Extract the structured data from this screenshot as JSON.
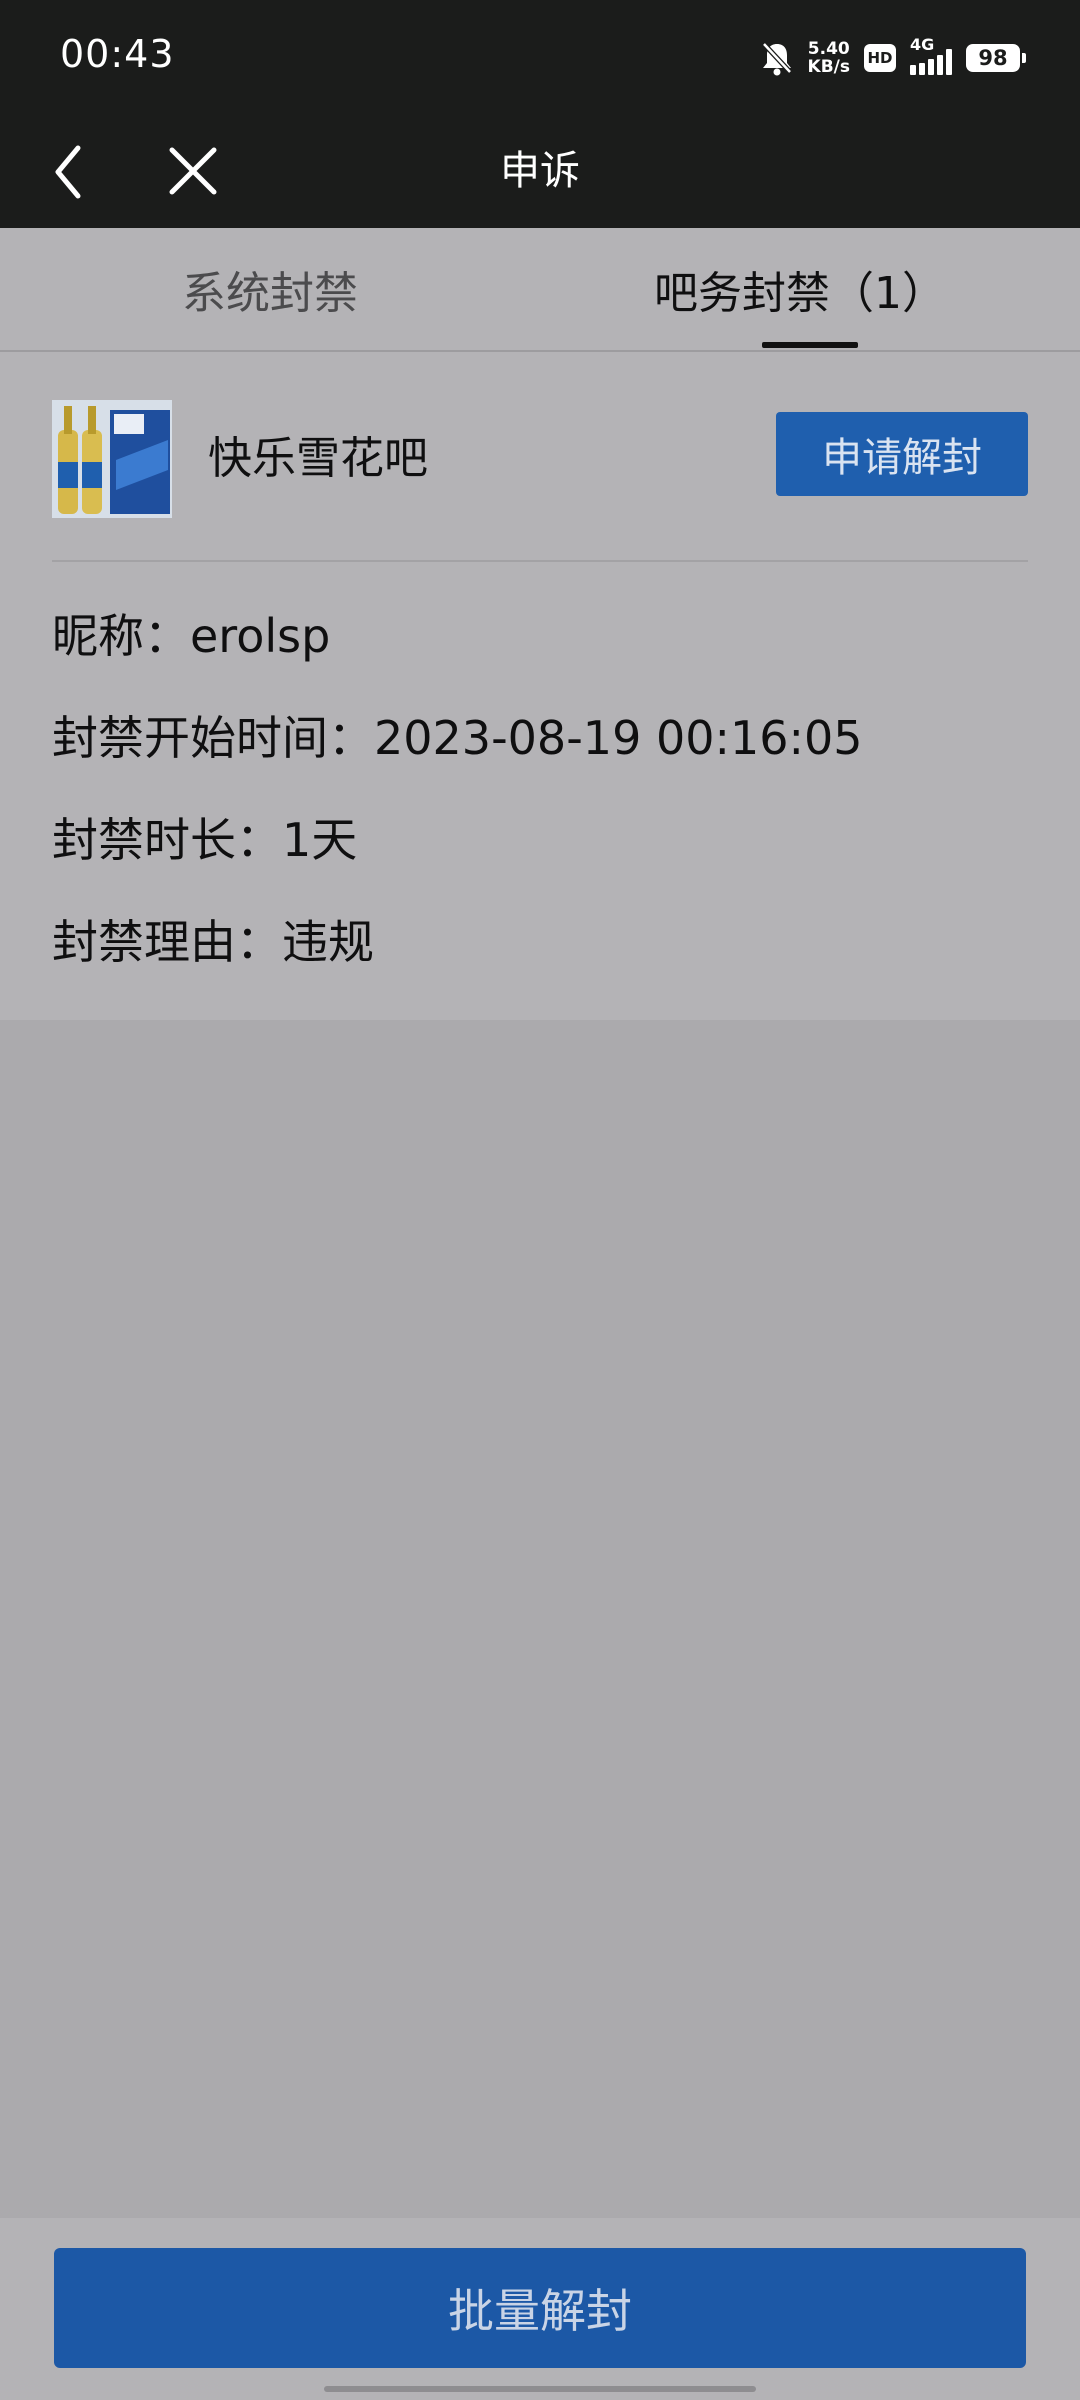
{
  "status_bar": {
    "time": "00:43",
    "net_speed_value": "5.40",
    "net_speed_unit": "KB/s",
    "hd_label": "HD",
    "signal_label": "4G",
    "battery": "98",
    "icons": [
      "bell-muted-icon",
      "hd-icon",
      "signal-icon",
      "battery-icon"
    ]
  },
  "title_bar": {
    "title": "申诉",
    "back_icon": "chevron-left-icon",
    "close_icon": "close-icon"
  },
  "tabs": [
    {
      "label": "系统封禁",
      "selected": false
    },
    {
      "label": "吧务封禁（1）",
      "selected": true
    }
  ],
  "ban_card": {
    "forum_name": "快乐雪花吧",
    "unban_button": "申请解封",
    "nickname_line": "昵称：erolsp",
    "start_time_line": "封禁开始时间：2023-08-19 00:16:05",
    "duration_line": "封禁时长：1天",
    "reason_line": "封禁理由：违规"
  },
  "bottom": {
    "batch_button": "批量解封"
  },
  "colors": {
    "header_bg": "#1b1c1b",
    "accent_blue": "#1f5fae",
    "dim_overlay_bg": "#abaaad"
  }
}
